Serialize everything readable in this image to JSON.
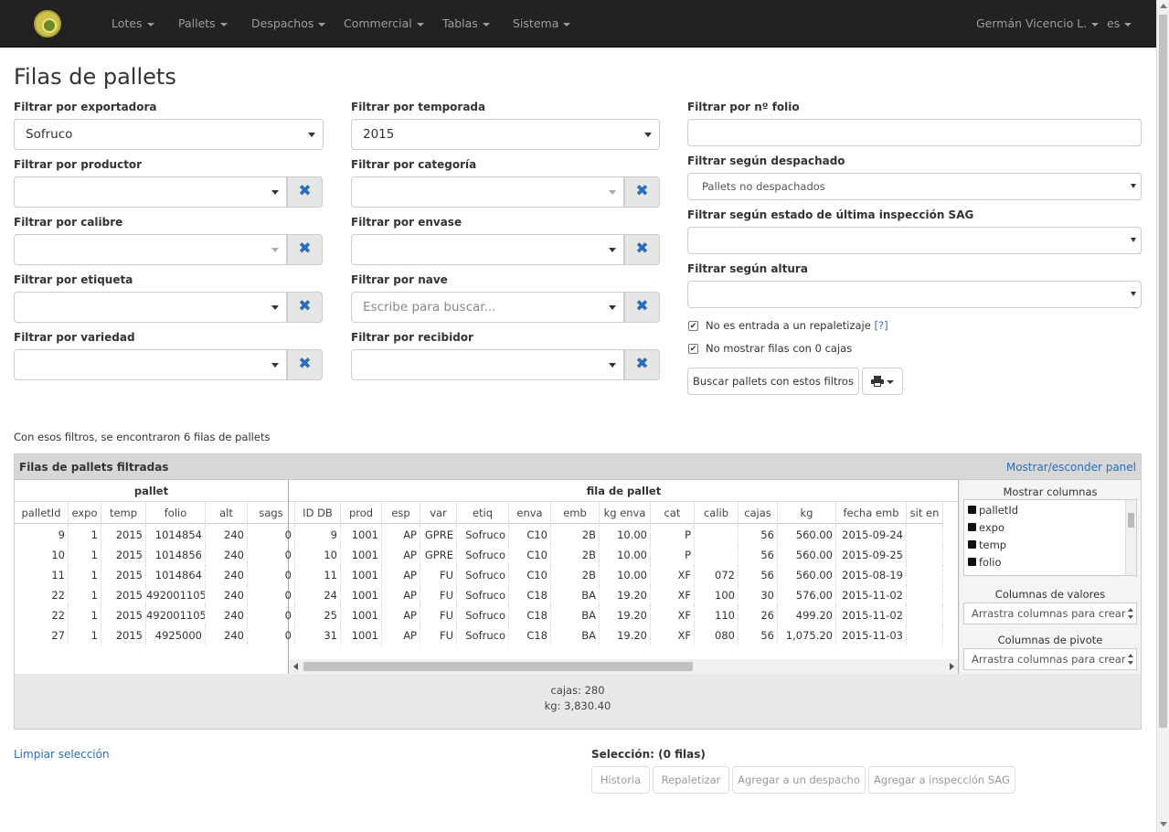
{
  "nav": {
    "items": [
      "Lotes",
      "Pallets",
      "Despachos",
      "Commercial",
      "Tablas",
      "Sistema"
    ],
    "user": "Germán Vicencio L.",
    "lang": "es"
  },
  "page_title": "Filas de pallets",
  "filters": {
    "exportadora": {
      "label": "Filtrar por exportadora",
      "value": "Sofruco"
    },
    "temporada": {
      "label": "Filtrar por temporada",
      "value": "2015"
    },
    "folio": {
      "label": "Filtrar por nº folio",
      "value": ""
    },
    "productor": {
      "label": "Filtrar por productor",
      "value": ""
    },
    "categoria": {
      "label": "Filtrar por categoría",
      "value": ""
    },
    "despachado": {
      "label": "Filtrar según despachado",
      "value": "Pallets no despachados"
    },
    "calibre": {
      "label": "Filtrar por calibre",
      "value": ""
    },
    "envase": {
      "label": "Filtrar por envase",
      "value": ""
    },
    "inspeccion": {
      "label": "Filtrar según estado de última inspección SAG",
      "value": ""
    },
    "etiqueta": {
      "label": "Filtrar por etiqueta",
      "value": ""
    },
    "nave": {
      "label": "Filtrar por nave",
      "placeholder": "Escribe para buscar..."
    },
    "altura": {
      "label": "Filtrar según altura",
      "value": ""
    },
    "variedad": {
      "label": "Filtrar por variedad",
      "value": ""
    },
    "recibidor": {
      "label": "Filtrar por recibidor",
      "value": ""
    }
  },
  "checks": {
    "repaletizaje": {
      "label": "No es entrada a un repaletizaje",
      "help": "[?]",
      "checked": true
    },
    "cero_cajas": {
      "label": "No mostrar filas con 0 cajas",
      "checked": true
    }
  },
  "buttons": {
    "search": "Buscar pallets con estos filtros"
  },
  "found_text": "Con esos filtros, se encontraron 6 filas de pallets",
  "panel": {
    "title": "Filas de pallets filtradas",
    "toggle": "Mostrar/esconder panel"
  },
  "grid": {
    "group_left": "pallet",
    "group_right": "fila de pallet",
    "columns": [
      "palletId",
      "expo",
      "temp",
      "folio",
      "alt",
      "sags",
      "ID DB",
      "prod",
      "esp",
      "var",
      "etiq",
      "enva",
      "emb",
      "kg enva",
      "cat",
      "calib",
      "cajas",
      "kg",
      "fecha emb",
      "sit en"
    ],
    "rows": [
      [
        "9",
        "1",
        "2015",
        "1014854",
        "240",
        "0",
        "9",
        "1001",
        "AP",
        "GPRE",
        "Sofruco",
        "C10",
        "2B",
        "10.00",
        "P",
        "",
        "56",
        "560.00",
        "2015-09-24",
        ""
      ],
      [
        "10",
        "1",
        "2015",
        "1014856",
        "240",
        "0",
        "10",
        "1001",
        "AP",
        "GPRE",
        "Sofruco",
        "C10",
        "2B",
        "10.00",
        "P",
        "",
        "56",
        "560.00",
        "2015-09-25",
        ""
      ],
      [
        "11",
        "1",
        "2015",
        "1014864",
        "240",
        "0",
        "11",
        "1001",
        "AP",
        "FU",
        "Sofruco",
        "C10",
        "2B",
        "10.00",
        "XF",
        "072",
        "56",
        "560.00",
        "2015-08-19",
        ""
      ],
      [
        "22",
        "1",
        "2015",
        "492001105",
        "240",
        "0",
        "24",
        "1001",
        "AP",
        "FU",
        "Sofruco",
        "C18",
        "BA",
        "19.20",
        "XF",
        "100",
        "30",
        "576.00",
        "2015-11-02",
        ""
      ],
      [
        "22",
        "1",
        "2015",
        "492001105",
        "240",
        "0",
        "25",
        "1001",
        "AP",
        "FU",
        "Sofruco",
        "C18",
        "BA",
        "19.20",
        "XF",
        "110",
        "26",
        "499.20",
        "2015-11-02",
        ""
      ],
      [
        "27",
        "1",
        "2015",
        "4925000",
        "240",
        "0",
        "31",
        "1001",
        "AP",
        "FU",
        "Sofruco",
        "C18",
        "BA",
        "19.20",
        "XF",
        "080",
        "56",
        "1,075.20",
        "2015-11-03",
        ""
      ]
    ]
  },
  "side": {
    "show_columns": "Mostrar columnas",
    "column_list": [
      "palletId",
      "expo",
      "temp",
      "folio"
    ],
    "values_title": "Columnas de valores",
    "pivot_title": "Columnas de pivote",
    "drop_placeholder": "Arrastra columnas para crear"
  },
  "totals": {
    "cajas": "cajas: 280",
    "kg": "kg: 3,830.40"
  },
  "footer": {
    "clear": "Limpiar selección",
    "selection": "Selección: (0 filas)",
    "actions": [
      "Historia",
      "Repaletizar",
      "Agregar a un despacho",
      "Agregar a inspección SAG"
    ]
  }
}
